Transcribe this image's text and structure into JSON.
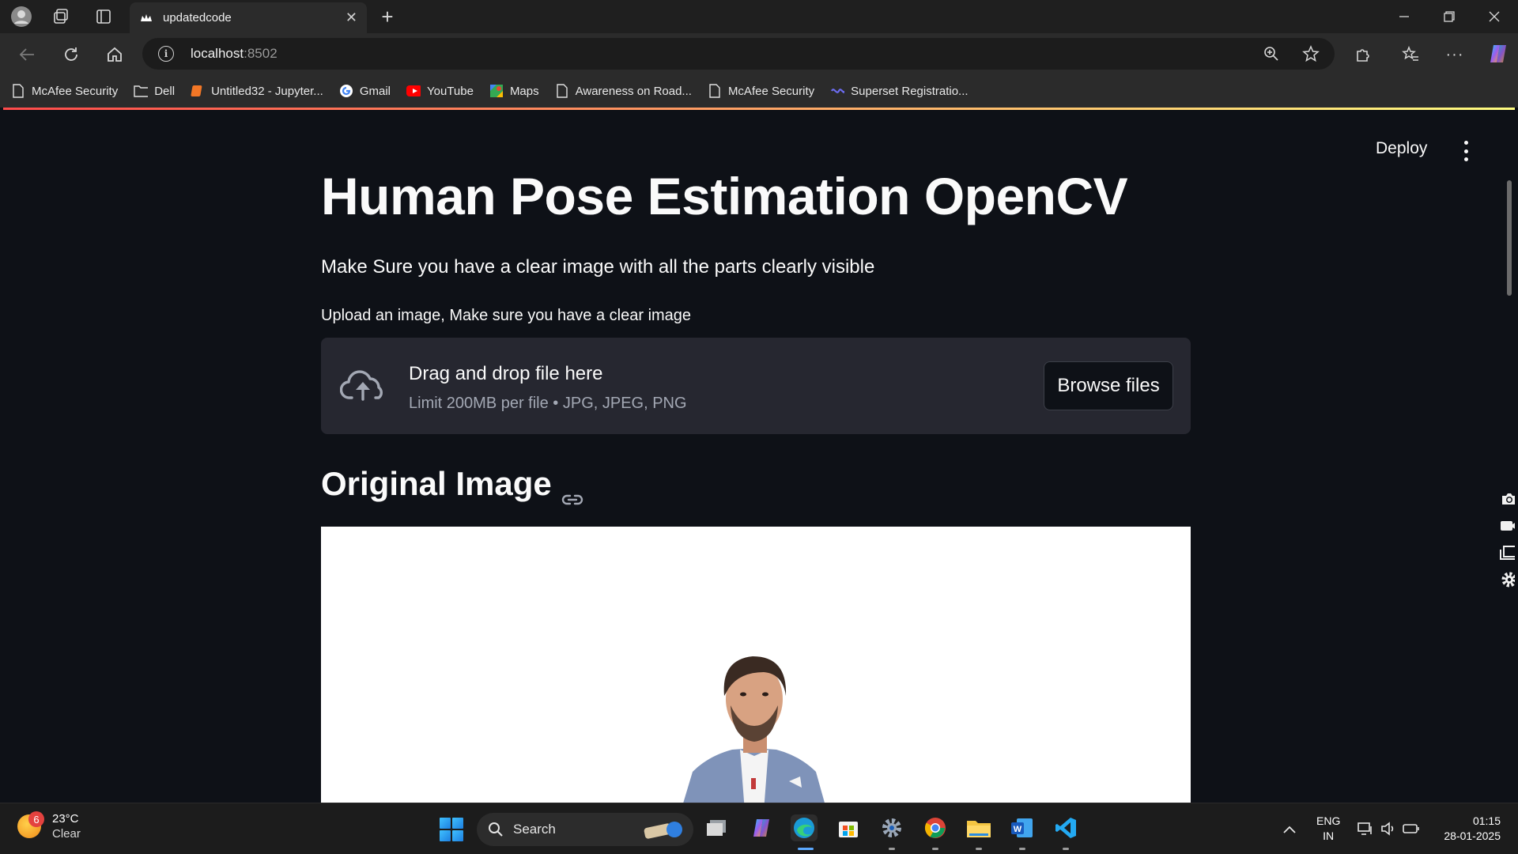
{
  "browser": {
    "tab_title": "updatedcode",
    "url_host": "localhost",
    "url_port": ":8502",
    "bookmarks": [
      {
        "label": "McAfee Security",
        "icon": "page-icon"
      },
      {
        "label": "Dell",
        "icon": "folder-icon"
      },
      {
        "label": "Untitled32 - Jupyter...",
        "icon": "jupyter-icon"
      },
      {
        "label": "Gmail",
        "icon": "google-icon"
      },
      {
        "label": "YouTube",
        "icon": "youtube-icon"
      },
      {
        "label": "Maps",
        "icon": "maps-icon"
      },
      {
        "label": "Awareness on Road...",
        "icon": "page-icon"
      },
      {
        "label": "McAfee Security",
        "icon": "page-icon"
      },
      {
        "label": "Superset Registratio...",
        "icon": "superset-icon"
      }
    ]
  },
  "app": {
    "deploy_label": "Deploy",
    "title": "Human Pose Estimation OpenCV",
    "subtitle": "Make Sure you have a clear image with all the parts clearly visible",
    "uploader": {
      "label": "Upload an image, Make sure you have a clear image",
      "drop_text": "Drag and drop file here",
      "limit_text": "Limit 200MB per file • JPG, JPEG, PNG",
      "browse_label": "Browse files"
    },
    "section_heading": "Original Image"
  },
  "taskbar": {
    "weather": {
      "badge": "6",
      "temp": "23°C",
      "condition": "Clear"
    },
    "search_label": "Search",
    "lang_line1": "ENG",
    "lang_line2": "IN",
    "time": "01:15",
    "date": "28-01-2025"
  },
  "colors": {
    "app_bg": "#0e1117",
    "dropzone_bg": "#262730",
    "accent_gradient_start": "#ff4b4b",
    "accent_gradient_end": "#fffd80"
  }
}
